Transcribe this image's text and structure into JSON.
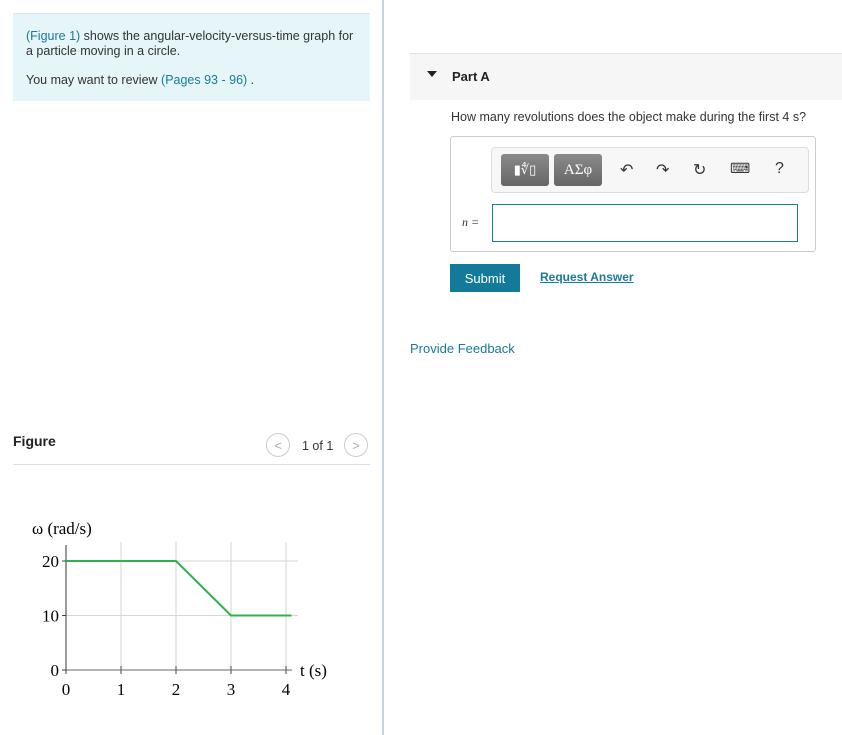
{
  "intro": {
    "figure_link": "(Figure 1)",
    "text": " shows the angular-velocity-versus-time graph for a particle moving in a circle.",
    "review_prefix": "You may want to review ",
    "review_link": "(Pages 93 - 96)",
    "review_suffix": " ."
  },
  "figure": {
    "title": "Figure",
    "pager": "1 of 1",
    "prev_icon": "chevron-left-icon",
    "next_icon": "chevron-right-icon"
  },
  "part": {
    "label": "Part A",
    "question": "How many revolutions does the object make during the first 4 s?",
    "toolbar": {
      "template_icon": "fraction-root-icon",
      "greek_label": "ΑΣφ",
      "undo_icon": "undo-icon",
      "redo_icon": "redo-icon",
      "reset_icon": "reset-icon",
      "keyboard_icon": "keyboard-icon",
      "help_label": "?"
    },
    "variable_label": "n =",
    "answer_value": "",
    "submit_label": "Submit",
    "request_label": "Request Answer"
  },
  "feedback_label": "Provide Feedback",
  "chart_data": {
    "type": "line",
    "ylabel": "ω (rad/s)",
    "xlabel": "t (s)",
    "x_ticks": [
      "0",
      "1",
      "2",
      "3",
      "4"
    ],
    "y_ticks": [
      "0",
      "10",
      "20"
    ],
    "xlim": [
      0,
      4
    ],
    "ylim": [
      0,
      20
    ],
    "grid": true,
    "series": [
      {
        "x": [
          0,
          2,
          3,
          4.1
        ],
        "y": [
          20,
          20,
          10,
          10
        ],
        "color": "#2db34a"
      }
    ]
  }
}
